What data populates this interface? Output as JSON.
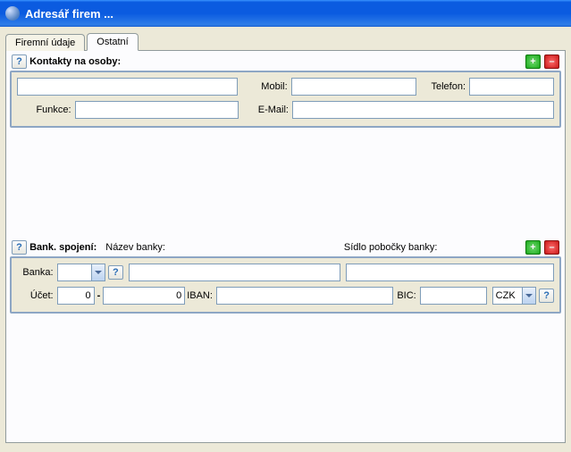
{
  "window": {
    "title": "Adresář firem ..."
  },
  "tabs": {
    "firemni": "Firemní údaje",
    "ostatni": "Ostatní"
  },
  "contacts": {
    "heading": "Kontakty na osoby:",
    "help": "?",
    "add": "+",
    "del": "–",
    "labels": {
      "mobil": "Mobil:",
      "telefon": "Telefon:",
      "funkce": "Funkce:",
      "email": "E-Mail:"
    },
    "values": {
      "name": "",
      "mobil": "",
      "telefon": "",
      "funkce": "",
      "email": ""
    }
  },
  "bank": {
    "heading": "Bank. spojení:",
    "nazev_label": "Název banky:",
    "sidlo_label": "Sídlo pobočky banky:",
    "help": "?",
    "add": "+",
    "del": "–",
    "labels": {
      "banka": "Banka:",
      "ucet": "Účet:",
      "dash": "-",
      "iban": "IBAN:",
      "bic": "BIC:"
    },
    "values": {
      "banka": "",
      "nazev": "",
      "sidlo": "",
      "ucet_prefix": "0",
      "ucet_main": "0",
      "iban": "",
      "bic": "",
      "currency": "CZK"
    },
    "q": "?"
  }
}
